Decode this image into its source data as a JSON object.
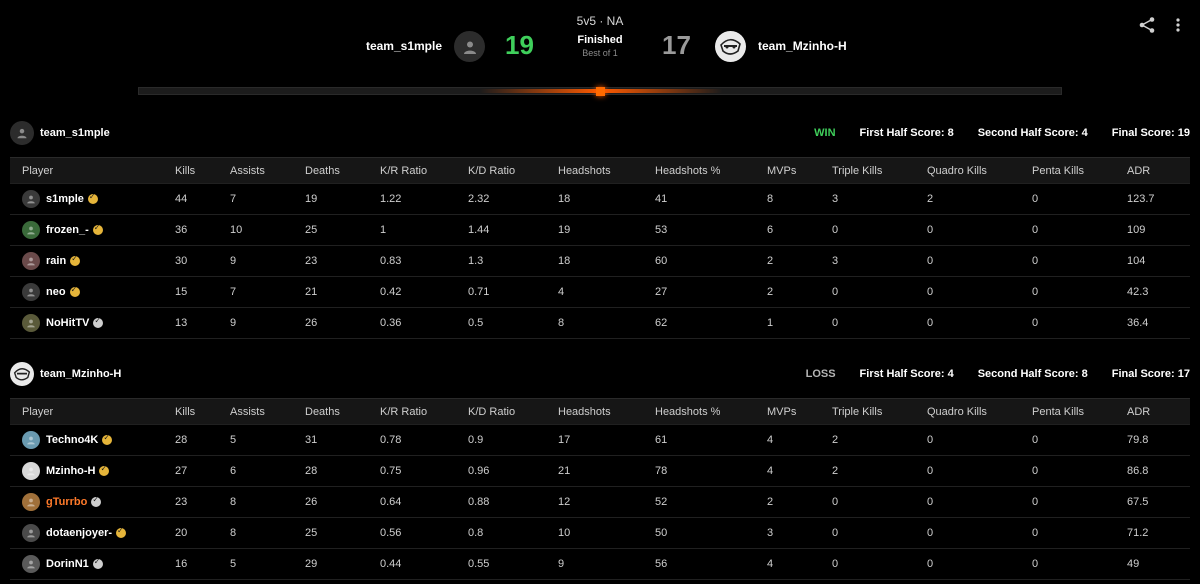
{
  "match": {
    "mode": "5v5 · NA",
    "status": "Finished",
    "best_of": "Best of 1"
  },
  "team1": {
    "name": "team_s1mple",
    "score": "19",
    "score_color": "#3fcf5b",
    "avatar_icon": "user-silhouette-icon",
    "result": "WIN",
    "first_half": "First Half Score: 8",
    "second_half": "Second Half Score: 4",
    "final": "Final Score: 19"
  },
  "team2": {
    "name": "team_Mzinho-H",
    "score": "17",
    "score_color": "#9a9a9a",
    "avatar_icon": "sketch-avatar-icon",
    "result": "LOSS",
    "first_half": "First Half Score: 4",
    "second_half": "Second Half Score: 8",
    "final": "Final Score: 17"
  },
  "columns": [
    "Player",
    "Kills",
    "Assists",
    "Deaths",
    "K/R Ratio",
    "K/D Ratio",
    "Headshots",
    "Headshots %",
    "MVPs",
    "Triple Kills",
    "Quadro Kills",
    "Penta Kills",
    "ADR"
  ],
  "team1_players": [
    {
      "name": "s1mple",
      "badge": "gold",
      "avatar": "#3a3a3a",
      "stats": [
        "44",
        "7",
        "19",
        "1.22",
        "2.32",
        "18",
        "41",
        "8",
        "3",
        "2",
        "0",
        "123.7"
      ]
    },
    {
      "name": "frozen_-",
      "badge": "gold",
      "avatar": "#3a6a3a",
      "stats": [
        "36",
        "10",
        "25",
        "1",
        "1.44",
        "19",
        "53",
        "6",
        "0",
        "0",
        "0",
        "109"
      ]
    },
    {
      "name": "rain",
      "badge": "gold",
      "avatar": "#6a4a4a",
      "stats": [
        "30",
        "9",
        "23",
        "0.83",
        "1.3",
        "18",
        "60",
        "2",
        "3",
        "0",
        "0",
        "104"
      ]
    },
    {
      "name": "neo",
      "badge": "gold",
      "avatar": "#3a3a3a",
      "stats": [
        "15",
        "7",
        "21",
        "0.42",
        "0.71",
        "4",
        "27",
        "2",
        "0",
        "0",
        "0",
        "42.3"
      ]
    },
    {
      "name": "NoHitTV",
      "badge": "grey",
      "avatar": "#5a5a3a",
      "stats": [
        "13",
        "9",
        "26",
        "0.36",
        "0.5",
        "8",
        "62",
        "1",
        "0",
        "0",
        "0",
        "36.4"
      ]
    }
  ],
  "team2_players": [
    {
      "name": "Techno4K",
      "badge": "gold",
      "avatar": "#6a9ab0",
      "stats": [
        "28",
        "5",
        "31",
        "0.78",
        "0.9",
        "17",
        "61",
        "4",
        "2",
        "0",
        "0",
        "79.8"
      ]
    },
    {
      "name": "Mzinho-H",
      "badge": "gold",
      "avatar": "#d8d8d8",
      "stats": [
        "27",
        "6",
        "28",
        "0.75",
        "0.96",
        "21",
        "78",
        "4",
        "2",
        "0",
        "0",
        "86.8"
      ]
    },
    {
      "name": "gTurrbo",
      "badge": "grey",
      "avatar": "#a0703a",
      "orange": true,
      "stats": [
        "23",
        "8",
        "26",
        "0.64",
        "0.88",
        "12",
        "52",
        "2",
        "0",
        "0",
        "0",
        "67.5"
      ]
    },
    {
      "name": "dotaenjoyer-",
      "badge": "gold",
      "avatar": "#4a4a4a",
      "stats": [
        "20",
        "8",
        "25",
        "0.56",
        "0.8",
        "10",
        "50",
        "3",
        "0",
        "0",
        "0",
        "71.2"
      ]
    },
    {
      "name": "DorinN1",
      "badge": "grey",
      "avatar": "#5a5a5a",
      "stats": [
        "16",
        "5",
        "29",
        "0.44",
        "0.55",
        "9",
        "56",
        "4",
        "0",
        "0",
        "0",
        "49"
      ]
    }
  ],
  "colors": {
    "accent": "#ff5a00",
    "win": "#3fcf5b",
    "badge_gold": "#e6b53a"
  }
}
